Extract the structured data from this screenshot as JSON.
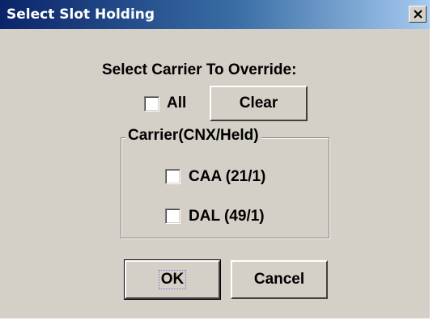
{
  "window": {
    "title": "Select Slot Holding",
    "close_icon": "close-icon"
  },
  "prompt": "Select Carrier To Override:",
  "all_option": {
    "label": "All",
    "checked": false
  },
  "clear_button": "Clear",
  "group": {
    "legend": "Carrier(CNX/Held)",
    "carriers": [
      {
        "label": "CAA (21/1)",
        "checked": false
      },
      {
        "label": "DAL (49/1)",
        "checked": false
      }
    ]
  },
  "ok_button": "OK",
  "cancel_button": "Cancel"
}
